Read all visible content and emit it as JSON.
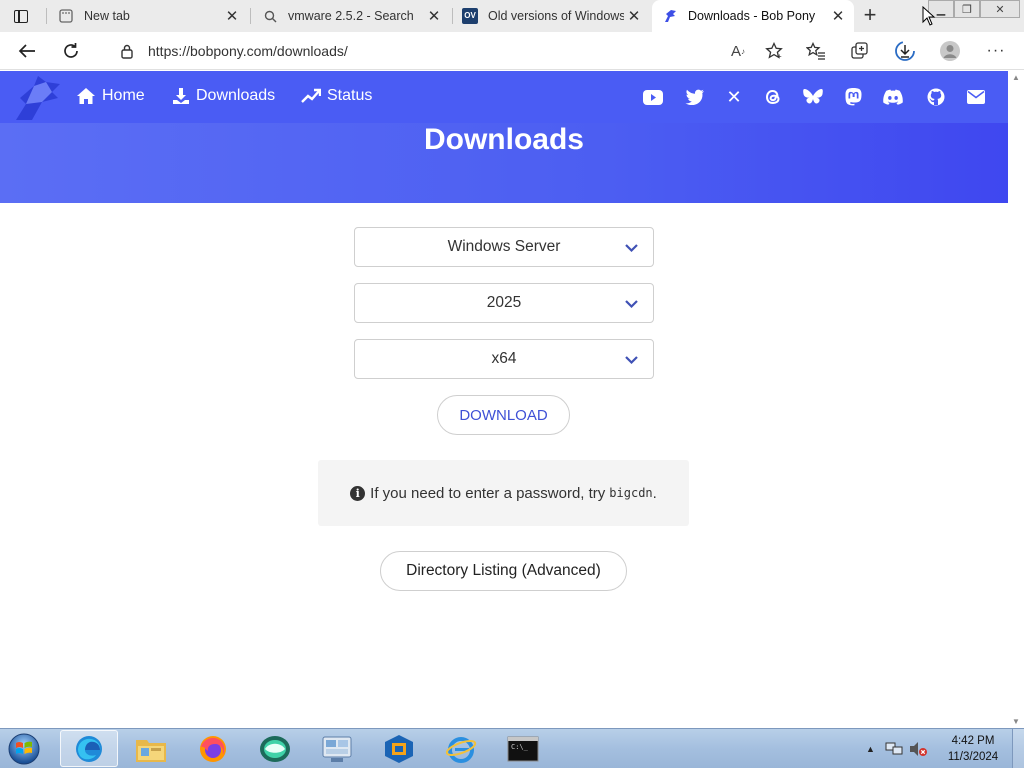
{
  "browser": {
    "tabs": [
      {
        "title": "New tab",
        "icon": "newtab-icon",
        "active": false
      },
      {
        "title": "vmware 2.5.2 - Search",
        "icon": "search-icon",
        "active": false
      },
      {
        "title": "Old versions of Windows",
        "icon": "ov-icon",
        "favicon_text": "OV",
        "active": false
      },
      {
        "title": "Downloads - Bob Pony",
        "icon": "bobpony-icon",
        "active": true
      }
    ],
    "new_tab_label": "+",
    "url": "https://bobpony.com/downloads/"
  },
  "site": {
    "nav": [
      {
        "label": "Home",
        "icon": "home-icon"
      },
      {
        "label": "Downloads",
        "icon": "download-icon"
      },
      {
        "label": "Status",
        "icon": "trend-icon"
      }
    ],
    "social": [
      "youtube-icon",
      "twitter-icon",
      "x-icon",
      "threads-icon",
      "bluesky-icon",
      "mastodon-icon",
      "discord-icon",
      "github-icon",
      "email-icon"
    ],
    "accent": "#4a5cf4"
  },
  "page": {
    "title": "Downloads",
    "selects": {
      "product": "Windows Server",
      "version": "2025",
      "arch": "x64"
    },
    "download_label": "DOWNLOAD",
    "note_text": "If you need to enter a password, try",
    "note_code": "bigcdn",
    "note_end": ".",
    "directory_label": "Directory Listing (Advanced)"
  },
  "taskbar": {
    "apps": [
      "edge-icon",
      "explorer-icon",
      "firefox-icon",
      "app-icon",
      "vmware-icon",
      "virtualbox-icon",
      "ie-icon",
      "cmd-icon"
    ],
    "time": "4:42 PM",
    "date": "11/3/2024"
  }
}
